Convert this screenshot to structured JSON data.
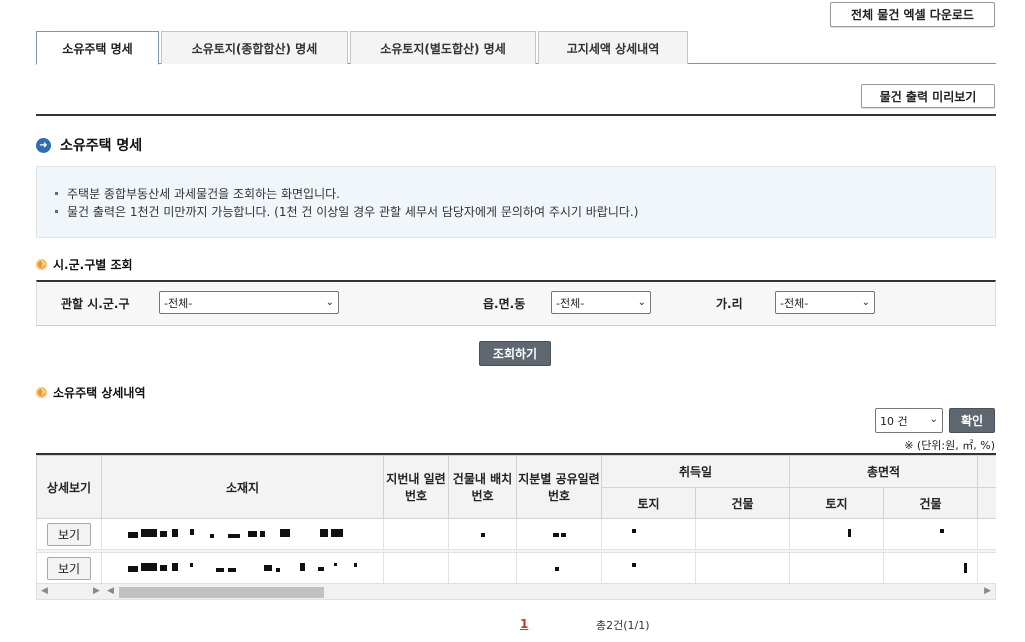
{
  "toolbar": {
    "excel_download": "전체 물건 엑셀 다운로드",
    "print_preview": "물건 출력 미리보기"
  },
  "tabs": [
    {
      "label": "소유주택 명세",
      "active": true
    },
    {
      "label": "소유토지(종합합산) 명세",
      "active": false
    },
    {
      "label": "소유토지(별도합산) 명세",
      "active": false
    },
    {
      "label": "고지세액 상세내역",
      "active": false
    }
  ],
  "section": {
    "title": "소유주택 명세",
    "info": [
      "주택분 종합부동산세 과세물건을 조회하는 화면입니다.",
      "물건 출력은 1천건 미만까지 가능합니다. (1천 건 이상일 경우 관할 세무서 담당자에게 문의하여 주시기 바랍니다.)"
    ]
  },
  "filter": {
    "title": "시.군.구별 조회",
    "sigungu_label": "관할 시.군.구",
    "sigungu_value": "-전체-",
    "eupmyeondong_label": "읍.면.동",
    "eupmyeondong_value": "-전체-",
    "gari_label": "가.리",
    "gari_value": "-전체-",
    "search_button": "조회하기"
  },
  "detail": {
    "title": "소유주택 상세내역",
    "page_size": "10 건",
    "confirm_button": "확인",
    "unit_note": "※ (단위:원, ㎡, %)",
    "headers": {
      "view": "상세보기",
      "address": "소재지",
      "lot_serial": "지번내 일련번호",
      "building_serial": "건물내 배치번호",
      "share_serial": "지분별 공유일련번호",
      "acquisition": "취득일",
      "total_area": "총면적",
      "land": "토지",
      "building": "건물"
    },
    "rows": [
      {
        "view_label": "보기"
      },
      {
        "view_label": "보기"
      }
    ]
  },
  "pagination": {
    "current_page": "1",
    "total": "총2건(1/1)"
  },
  "colors": {
    "accent_blue": "#2f6db0",
    "accent_orange": "#e8962c",
    "page_red": "#c0392b",
    "dark_button": "#5f6770"
  }
}
